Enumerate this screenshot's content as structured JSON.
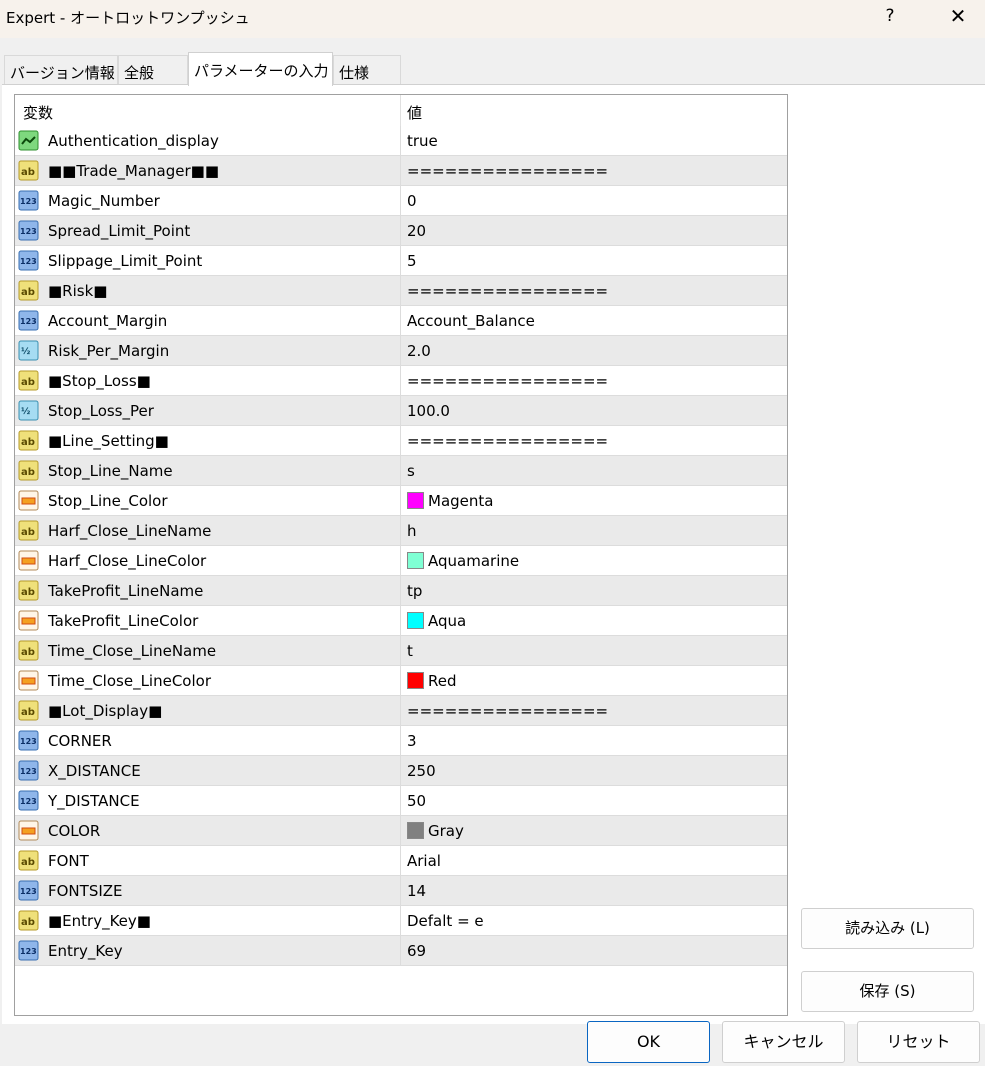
{
  "window": {
    "title": "Expert - オートロットワンプッシュ",
    "help": "?",
    "close": "✕"
  },
  "tabs": [
    {
      "label": "バージョン情報"
    },
    {
      "label": "全般"
    },
    {
      "label": "パラメーターの入力"
    },
    {
      "label": "仕様"
    }
  ],
  "grid": {
    "header": {
      "name": "変数",
      "value": "値"
    },
    "rows": [
      {
        "icon": "bool",
        "name": "Authentication_display",
        "value": "true",
        "color": null
      },
      {
        "icon": "string",
        "name": "■■Trade_Manager■■",
        "value": "================",
        "color": null
      },
      {
        "icon": "int",
        "name": "Magic_Number",
        "value": "0",
        "color": null
      },
      {
        "icon": "int",
        "name": "Spread_Limit_Point",
        "value": "20",
        "color": null
      },
      {
        "icon": "int",
        "name": "Slippage_Limit_Point",
        "value": "5",
        "color": null
      },
      {
        "icon": "string",
        "name": "■Risk■",
        "value": "================",
        "color": null
      },
      {
        "icon": "int",
        "name": "Account_Margin",
        "value": "Account_Balance",
        "color": null
      },
      {
        "icon": "double",
        "name": "Risk_Per_Margin",
        "value": "2.0",
        "color": null
      },
      {
        "icon": "string",
        "name": "■Stop_Loss■",
        "value": "================",
        "color": null
      },
      {
        "icon": "double",
        "name": "Stop_Loss_Per",
        "value": "100.0",
        "color": null
      },
      {
        "icon": "string",
        "name": "■Line_Setting■",
        "value": "================",
        "color": null
      },
      {
        "icon": "string",
        "name": "Stop_Line_Name",
        "value": "s",
        "color": null
      },
      {
        "icon": "color",
        "name": "Stop_Line_Color",
        "value": "Magenta",
        "color": "#ff00ff"
      },
      {
        "icon": "string",
        "name": "Harf_Close_LineName",
        "value": "h",
        "color": null
      },
      {
        "icon": "color",
        "name": "Harf_Close_LineColor",
        "value": "Aquamarine",
        "color": "#7fffd4"
      },
      {
        "icon": "string",
        "name": "TakeProfit_LineName",
        "value": "tp",
        "color": null
      },
      {
        "icon": "color",
        "name": "TakeProfit_LineColor",
        "value": "Aqua",
        "color": "#00ffff"
      },
      {
        "icon": "string",
        "name": "Time_Close_LineName",
        "value": "t",
        "color": null
      },
      {
        "icon": "color",
        "name": "Time_Close_LineColor",
        "value": "Red",
        "color": "#ff0000"
      },
      {
        "icon": "string",
        "name": "■Lot_Display■",
        "value": "================",
        "color": null
      },
      {
        "icon": "int",
        "name": "CORNER",
        "value": "3",
        "color": null
      },
      {
        "icon": "int",
        "name": "X_DISTANCE",
        "value": "250",
        "color": null
      },
      {
        "icon": "int",
        "name": "Y_DISTANCE",
        "value": "50",
        "color": null
      },
      {
        "icon": "color",
        "name": "COLOR",
        "value": "Gray",
        "color": "#808080"
      },
      {
        "icon": "string",
        "name": "FONT",
        "value": "Arial",
        "color": null
      },
      {
        "icon": "int",
        "name": "FONTSIZE",
        "value": "14",
        "color": null
      },
      {
        "icon": "string",
        "name": "■Entry_Key■",
        "value": "Defalt = e",
        "color": null
      },
      {
        "icon": "int",
        "name": "Entry_Key",
        "value": "69",
        "color": null
      }
    ]
  },
  "side_buttons": {
    "load": "読み込み (L)",
    "save": "保存 (S)"
  },
  "buttons": {
    "ok": "OK",
    "cancel": "キャンセル",
    "reset": "リセット"
  }
}
